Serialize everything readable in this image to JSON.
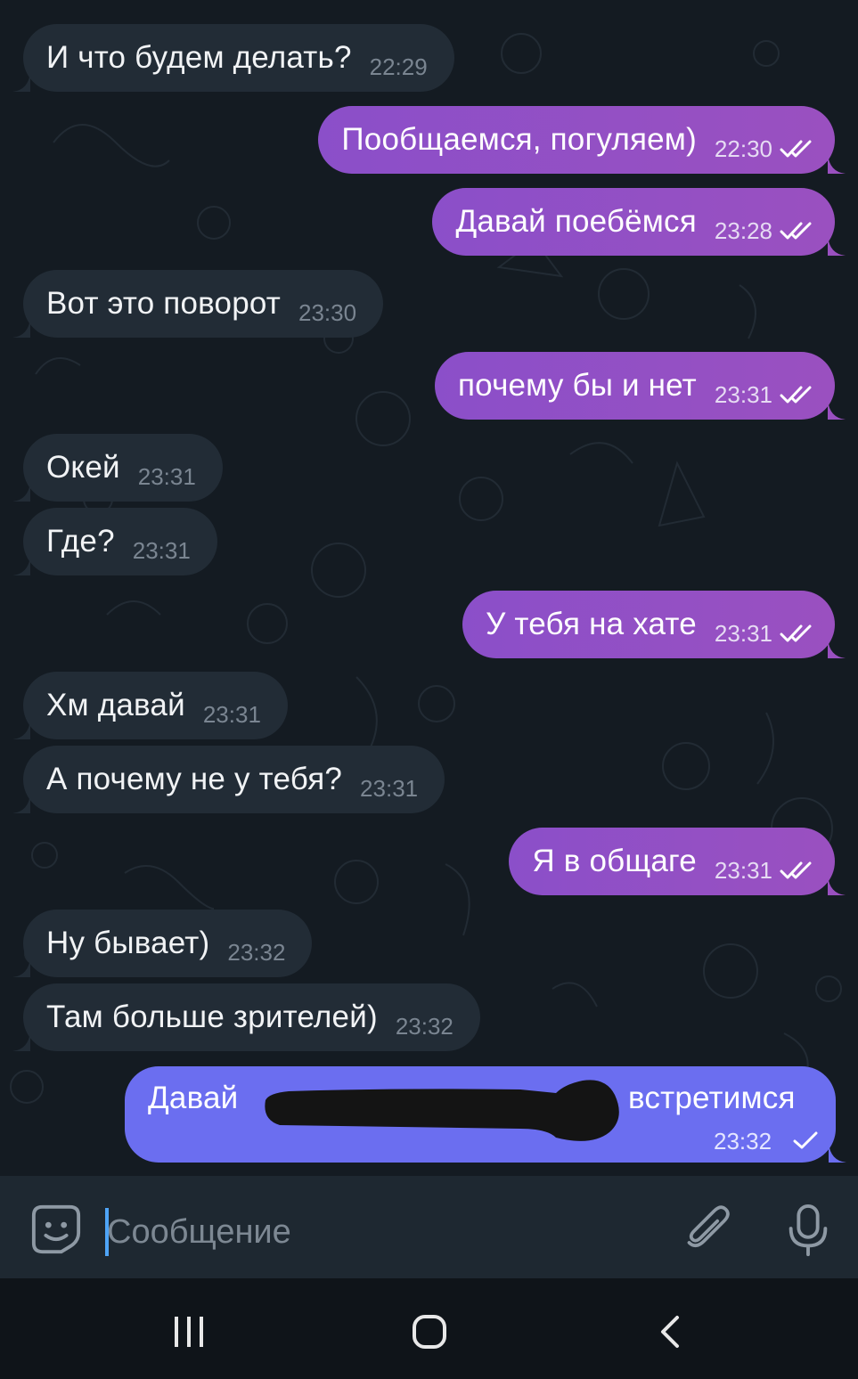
{
  "messages": [
    {
      "dir": "in",
      "text": "И что будем делать?",
      "time": "22:29"
    },
    {
      "dir": "out",
      "text": "Пообщаемся, погуляем)",
      "time": "22:30",
      "status": "read"
    },
    {
      "dir": "out",
      "text": "Давай поебёмся",
      "time": "23:28",
      "status": "read"
    },
    {
      "dir": "in",
      "text": "Вот это поворот",
      "time": "23:30"
    },
    {
      "dir": "out",
      "text": "почему бы и нет",
      "time": "23:31",
      "status": "read"
    },
    {
      "dir": "in",
      "text": "Окей",
      "time": "23:31"
    },
    {
      "dir": "in",
      "text": "Где?",
      "time": "23:31"
    },
    {
      "dir": "out",
      "text": "У тебя на хате",
      "time": "23:31",
      "status": "read"
    },
    {
      "dir": "in",
      "text": "Хм давай",
      "time": "23:31"
    },
    {
      "dir": "in",
      "text": "А почему не у тебя?",
      "time": "23:31"
    },
    {
      "dir": "out",
      "text": "Я в общаге",
      "time": "23:31",
      "status": "read"
    },
    {
      "dir": "in",
      "text": "Ну бывает)",
      "time": "23:32"
    },
    {
      "dir": "in",
      "text": "Там больше зрителей)",
      "time": "23:32"
    }
  ],
  "last_message": {
    "text_start": "Давай",
    "text_end": "встретимся",
    "time": "23:32",
    "status": "sent",
    "redacted": true
  },
  "composer": {
    "placeholder": "Сообщение",
    "emoji_icon": "sticker-icon",
    "attach_icon": "paperclip-icon",
    "mic_icon": "microphone-icon"
  },
  "navbar": {
    "recents_icon": "recents-icon",
    "home_icon": "home-icon",
    "back_icon": "back-icon"
  },
  "colors": {
    "background": "#141b22",
    "incoming": "#222c36",
    "outgoing": "#9250c4",
    "last_outgoing": "#6b6ef0",
    "input_bar": "#1e2831",
    "navbar": "#0f1419"
  }
}
